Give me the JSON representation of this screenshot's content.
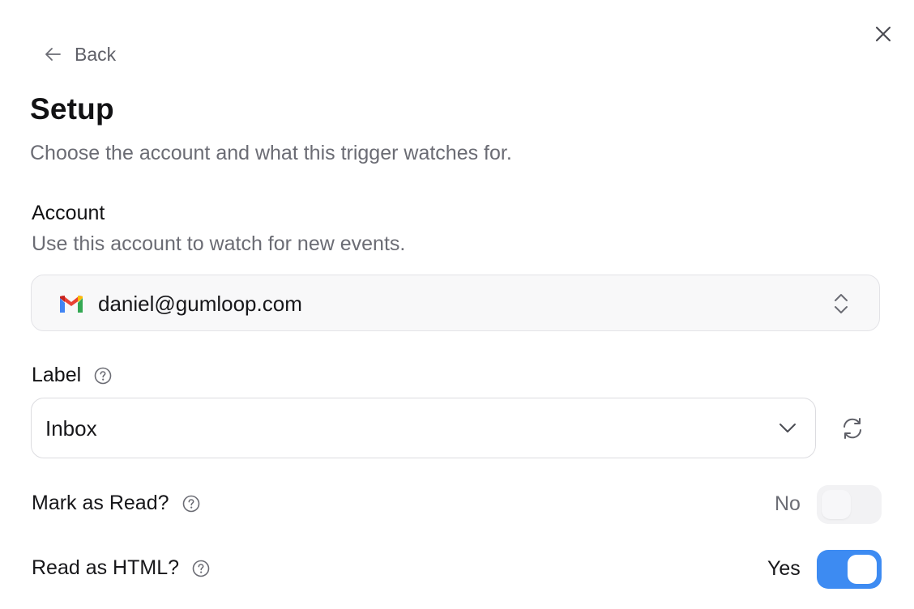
{
  "header": {
    "back_label": "Back",
    "title": "Setup",
    "subtitle": "Choose the account and what this trigger watches for."
  },
  "account": {
    "heading": "Account",
    "description": "Use this account to watch for new events.",
    "selected": "daniel@gumloop.com",
    "icon": "gmail-icon"
  },
  "label_field": {
    "heading": "Label",
    "selected": "Inbox"
  },
  "options": {
    "mark_as_read": {
      "label": "Mark as Read?",
      "value_text": "No",
      "enabled": false
    },
    "read_as_html": {
      "label": "Read as HTML?",
      "value_text": "Yes",
      "enabled": true
    }
  },
  "colors": {
    "toggle_on": "#3d8bf2",
    "toggle_off": "#f2f2f4",
    "muted_text": "#6b6c74"
  }
}
